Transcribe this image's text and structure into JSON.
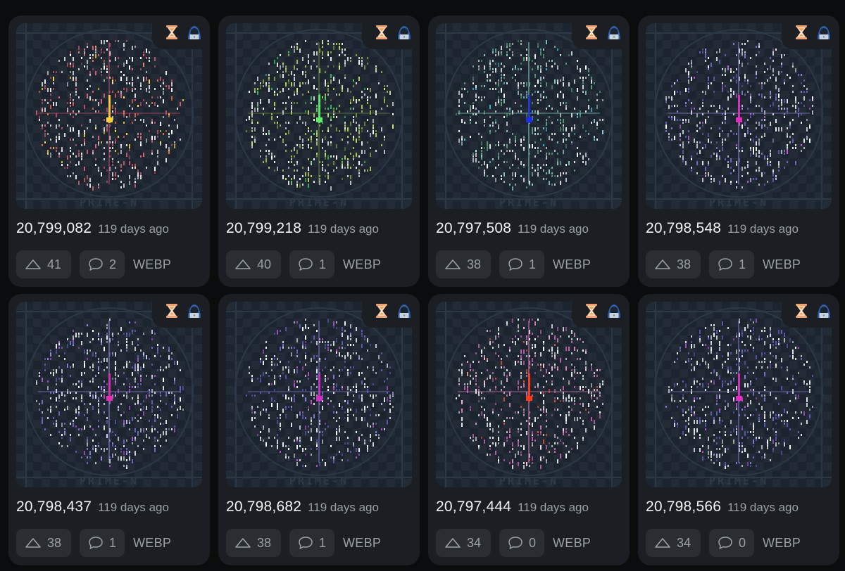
{
  "cards": [
    {
      "number": "20,799,082",
      "time": "119 days ago",
      "votes": "41",
      "comments": "2",
      "format": "WEBP",
      "palette": [
        "#ffffff",
        "#e8e8e8",
        "#e0607a",
        "#c94a6a",
        "#f07040",
        "#ffe040"
      ],
      "center": "#ffd23a"
    },
    {
      "number": "20,799,218",
      "time": "119 days ago",
      "votes": "40",
      "comments": "1",
      "format": "WEBP",
      "palette": [
        "#ffffff",
        "#e8e8e8",
        "#b8d858",
        "#6a8a38",
        "#4ad868",
        "#d8f070"
      ],
      "center": "#5cf06a"
    },
    {
      "number": "20,797,508",
      "time": "119 days ago",
      "votes": "38",
      "comments": "1",
      "format": "WEBP",
      "palette": [
        "#ffffff",
        "#e8e8e8",
        "#5a9a78",
        "#8ad0c0",
        "#40b8c8",
        "#a8e0f0"
      ],
      "center": "#2030e0"
    },
    {
      "number": "20,798,548",
      "time": "119 days ago",
      "votes": "38",
      "comments": "1",
      "format": "WEBP",
      "palette": [
        "#ffffff",
        "#e8e8e8",
        "#6a68c8",
        "#9a8ae0",
        "#c060d0",
        "#e0d8ff"
      ],
      "center": "#e030c0"
    },
    {
      "number": "20,798,437",
      "time": "119 days ago",
      "votes": "38",
      "comments": "1",
      "format": "WEBP",
      "palette": [
        "#ffffff",
        "#e8e8e8",
        "#6a68c8",
        "#9a8ae0",
        "#b050d0",
        "#e0d8ff"
      ],
      "center": "#e030b0"
    },
    {
      "number": "20,798,682",
      "time": "119 days ago",
      "votes": "38",
      "comments": "1",
      "format": "WEBP",
      "palette": [
        "#ffffff",
        "#e8e8e8",
        "#5a5ab8",
        "#8a7ad8",
        "#c050d0",
        "#e8e0ff"
      ],
      "center": "#d030c8"
    },
    {
      "number": "20,797,444",
      "time": "119 days ago",
      "votes": "34",
      "comments": "0",
      "format": "WEBP",
      "palette": [
        "#ffffff",
        "#e8e8e8",
        "#c060b0",
        "#e080c0",
        "#f05030",
        "#ffc0e0"
      ],
      "center": "#ff3a1a"
    },
    {
      "number": "20,798,566",
      "time": "119 days ago",
      "votes": "34",
      "comments": "0",
      "format": "WEBP",
      "palette": [
        "#ffffff",
        "#e8e8e8",
        "#5a5ab8",
        "#8a7ad8",
        "#b050d0",
        "#e8e0ff"
      ],
      "center": "#e030c0"
    }
  ],
  "badge_icons": [
    "hourglass-icon",
    "hacker-avatar-icon"
  ],
  "watermark": "PRIME-N",
  "colors": {
    "page_bg": "#0b0c0e",
    "card_bg": "#1b1e22",
    "pill_bg": "#2a2e33",
    "muted_text": "#9aa0a6",
    "thumb_bg": "#1c2430"
  }
}
